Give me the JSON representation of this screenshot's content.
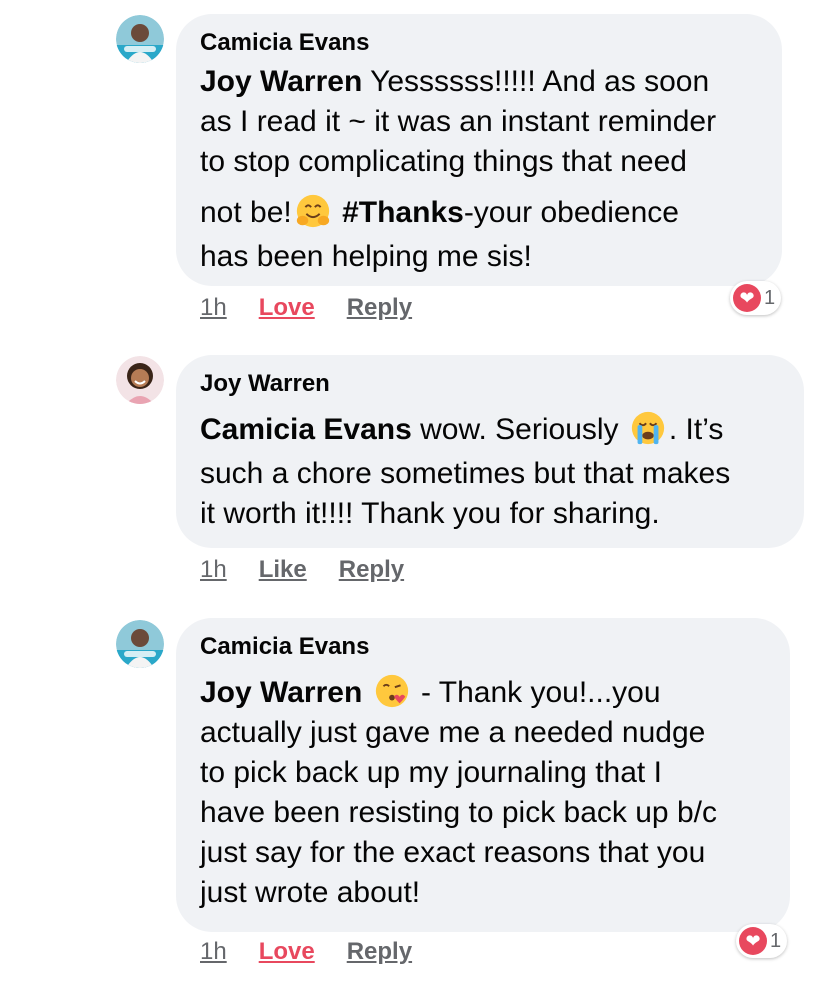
{
  "comments": [
    {
      "author": "Camicia Evans",
      "mention": "Joy Warren",
      "line1": " Yessssss!!!!! And as soon",
      "line2": "as I read it ~ it was an instant reminder",
      "line3": "to stop complicating things that need",
      "line4a": "not be!",
      "emoji": "hugging-face-emoji",
      "hashtag": "#Thanks",
      "line4b": "-your obedience",
      "line5": "has been helping me sis!",
      "time": "1h",
      "react_label": "Love",
      "reply_label": "Reply",
      "reaction_count": "1"
    },
    {
      "author": "Joy Warren",
      "mention": "Camicia Evans",
      "line1a": " wow. Seriously ",
      "emoji": "loudly-crying-face-emoji",
      "line1b": ". It’s",
      "line2": "such a chore sometimes but that makes",
      "line3": "it worth it!!!! Thank you for sharing.",
      "time": "1h",
      "react_label": "Like",
      "reply_label": "Reply"
    },
    {
      "author": "Camicia Evans",
      "mention": "Joy Warren",
      "emoji": "face-blowing-kiss-emoji",
      "line1": " - Thank you!...you",
      "line2": "actually just gave me a needed nudge",
      "line3": "to pick back up my journaling that I",
      "line4": "have been resisting to pick back up b/c",
      "line5": "just say for the exact reasons that you",
      "line6": "just wrote about!",
      "time": "1h",
      "react_label": "Love",
      "reply_label": "Reply",
      "reaction_count": "1"
    }
  ],
  "colors": {
    "bubble": "#f0f2f5",
    "love": "#e8485e",
    "meta": "#65676b",
    "avatar_ring": "#2aa8c9"
  }
}
